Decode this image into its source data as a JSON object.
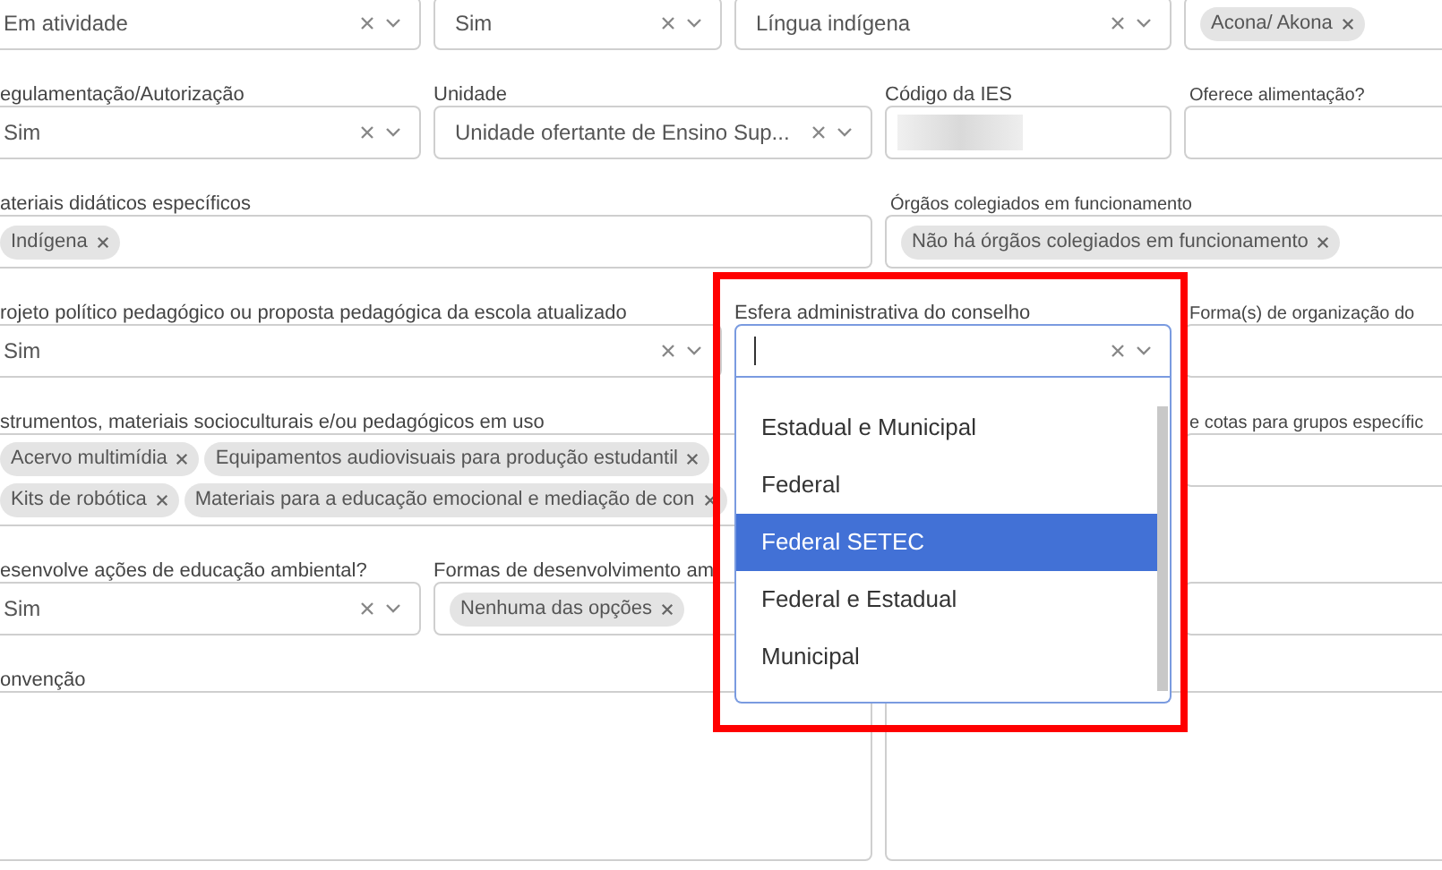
{
  "rows": [
    {
      "fields": [
        {
          "kind": "select",
          "value": "Em atividade"
        },
        {
          "kind": "select",
          "value": "Sim"
        },
        {
          "kind": "select",
          "value": "Língua indígena"
        },
        {
          "kind": "tags",
          "tags": [
            "Acona/ Akona"
          ]
        }
      ]
    },
    {
      "fields": [
        {
          "kind": "select",
          "label": "egulamentação/Autorização",
          "value": "Sim"
        },
        {
          "kind": "select",
          "label": "Unidade",
          "value": "Unidade ofertante de Ensino Sup..."
        },
        {
          "kind": "redacted",
          "label": "Código da IES"
        },
        {
          "kind": "text",
          "label": "Oferece alimentação?"
        }
      ]
    },
    {
      "fields": [
        {
          "kind": "tags",
          "label": "ateriais didáticos específicos",
          "tags": [
            "Indígena"
          ]
        },
        {
          "kind": "tags",
          "label": "Órgãos colegiados em funcionamento",
          "tags": [
            "Não há órgãos colegiados em funcionamento"
          ]
        }
      ]
    },
    {
      "fields": [
        {
          "kind": "select",
          "label": "rojeto político pedagógico ou proposta pedagógica da escola atualizado",
          "value": "Sim"
        },
        {
          "kind": "dropdown",
          "label": "Esfera administrativa do conselho",
          "open": true,
          "options": [
            {
              "label": "Estadual e Municipal",
              "selected": false
            },
            {
              "label": "Federal",
              "selected": false
            },
            {
              "label": "Federal SETEC",
              "selected": true
            },
            {
              "label": "Federal e Estadual",
              "selected": false
            },
            {
              "label": "Municipal",
              "selected": false
            }
          ]
        },
        {
          "kind": "text",
          "label": "Forma(s) de organização do"
        }
      ]
    },
    {
      "fields": [
        {
          "kind": "tags",
          "label": "strumentos, materiais socioculturais e/ou pedagógicos em uso",
          "tags": [
            "Acervo multimídia",
            "Equipamentos audiovisuais para produção estudantil",
            "Kits de robótica",
            "Materiais para a educação emocional e mediação de con"
          ]
        },
        {
          "kind": "text",
          "label": "e cotas para grupos específic"
        }
      ]
    },
    {
      "fields": [
        {
          "kind": "select",
          "label": "esenvolve ações de educação ambiental?",
          "value": "Sim"
        },
        {
          "kind": "tags",
          "label": "Formas de desenvolvimento am",
          "tags": [
            "Nenhuma das opções"
          ]
        },
        {
          "kind": "text"
        }
      ]
    },
    {
      "fields": [
        {
          "kind": "textarea",
          "label": "onvenção"
        },
        {
          "kind": "textarea"
        }
      ]
    }
  ],
  "highlight": true
}
